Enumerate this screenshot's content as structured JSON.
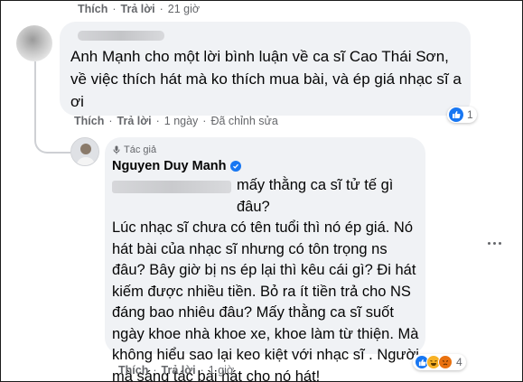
{
  "top_actions": {
    "like": "Thích",
    "reply": "Trả lời",
    "time": "21 giờ"
  },
  "comment1": {
    "text": "Anh Mạnh cho một lời bình luận về ca sĩ Cao Thái Sơn, về việc thích hát mà ko thích mua bài, và ép giá nhạc sĩ a ơi",
    "actions": {
      "like": "Thích",
      "reply": "Trả lời",
      "time": "1 ngày",
      "edited": "Đã chỉnh sửa"
    },
    "reaction_count": "1",
    "reaction_icon": "like-icon"
  },
  "reply": {
    "badge": "Tác giả",
    "author": "Nguyen Duy Manh",
    "first_line": "mấy thằng ca sĩ tử tế gì đâu?",
    "body": "Lúc nhạc sĩ chưa có tên tuổi thì nó ép giá. Nó hát bài của nhạc sĩ nhưng có tôn trọng ns đâu? Bây giờ bị ns ép lại thì kêu cái gì? Đi hát kiếm được nhiều tiền. Bỏ ra ít tiền trả cho NS đáng bao nhiêu đâu? Mấy thằng ca sĩ suốt ngày khoe nhà khoe xe, khoe làm từ thiện. Mà không hiểu sao lại keo kiệt với nhạc sĩ . Người mà sáng tác bài hát cho nó hát!",
    "actions": {
      "like": "Thích",
      "reply": "Trả lời",
      "time": "1 giờ"
    },
    "reaction_count": "4",
    "colors": {
      "like": "#1877f2",
      "haha": "#f7b125",
      "angry": "#e9710f"
    }
  }
}
